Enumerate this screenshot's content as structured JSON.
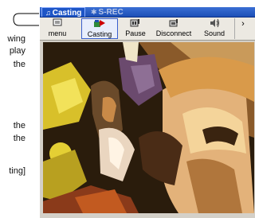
{
  "document": {
    "fragments": [
      "wing",
      "play",
      "the",
      "the",
      "the",
      "ting]"
    ]
  },
  "window": {
    "tabs": [
      {
        "label": "Casting",
        "icon": "casting-tab-icon",
        "active": true
      },
      {
        "label": "S-REC",
        "icon": "rec-tab-icon",
        "active": false
      }
    ],
    "toolbar": {
      "menu": {
        "label": "menu",
        "icon": "menu-icon"
      },
      "casting": {
        "label": "Casting",
        "icon": "cast-play-icon"
      },
      "pause": {
        "label": "Pause",
        "icon": "pause-icon"
      },
      "disconnect": {
        "label": "Disconnect",
        "icon": "disconnect-icon"
      },
      "sound": {
        "label": "Sound",
        "icon": "speaker-icon"
      },
      "more": {
        "icon": "more-icon"
      }
    }
  },
  "colors": {
    "titlebar": "#1c4fb6",
    "toolbar": "#ece9e2",
    "active_button_border": "#3a5fcd"
  }
}
